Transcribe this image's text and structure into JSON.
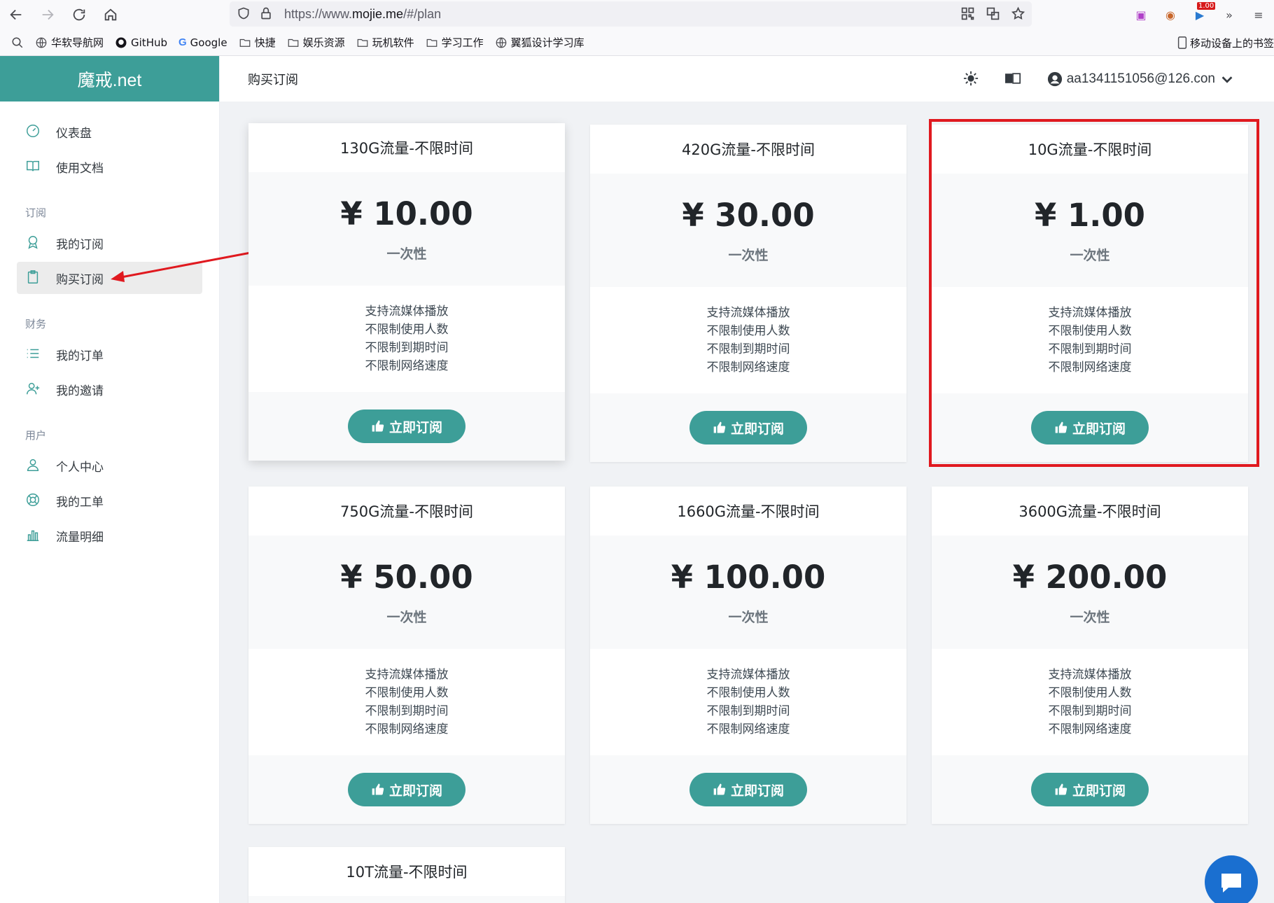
{
  "browser": {
    "url_prefix": "https://www.",
    "url_domain": "mojie.me",
    "url_path": "/#/plan",
    "bookmarks": [
      "华软导航网",
      "GitHub",
      "Google",
      "快捷",
      "娱乐资源",
      "玩机软件",
      "学习工作",
      "翼狐设计学习库"
    ],
    "mobile_bookmarks": "移动设备上的书签",
    "ext_badge": "1.00"
  },
  "app": {
    "brand": "魔戒.net",
    "page_title": "购买订阅",
    "user_email": "aa1341151056@126.con"
  },
  "sidebar": {
    "top_items": [
      {
        "label": "仪表盘",
        "icon": "dashboard-icon"
      },
      {
        "label": "使用文档",
        "icon": "book-icon"
      }
    ],
    "groups": [
      {
        "title": "订阅",
        "items": [
          {
            "label": "我的订阅",
            "icon": "award-icon"
          },
          {
            "label": "购买订阅",
            "icon": "clipboard-icon",
            "active": true
          }
        ]
      },
      {
        "title": "财务",
        "items": [
          {
            "label": "我的订单",
            "icon": "list-icon"
          },
          {
            "label": "我的邀请",
            "icon": "user-plus-icon"
          }
        ]
      },
      {
        "title": "用户",
        "items": [
          {
            "label": "个人中心",
            "icon": "user-icon"
          },
          {
            "label": "我的工单",
            "icon": "support-icon"
          },
          {
            "label": "流量明细",
            "icon": "bar-chart-icon"
          }
        ]
      }
    ]
  },
  "plans": [
    {
      "name": "130G流量-不限时间",
      "price": "¥ 10.00",
      "period": "一次性"
    },
    {
      "name": "420G流量-不限时间",
      "price": "¥ 30.00",
      "period": "一次性"
    },
    {
      "name": "10G流量-不限时间",
      "price": "¥ 1.00",
      "period": "一次性"
    },
    {
      "name": "750G流量-不限时间",
      "price": "¥ 50.00",
      "period": "一次性"
    },
    {
      "name": "1660G流量-不限时间",
      "price": "¥ 100.00",
      "period": "一次性"
    },
    {
      "name": "3600G流量-不限时间",
      "price": "¥ 200.00",
      "period": "一次性"
    },
    {
      "name": "10T流量-不限时间",
      "price": "",
      "period": ""
    }
  ],
  "features": [
    "支持流媒体播放",
    "不限制使用人数",
    "不限制到期时间",
    "不限制网络速度"
  ],
  "subscribe_label": "立即订阅",
  "colors": {
    "brand": "#3d9e98",
    "highlight": "#e0191f",
    "chat": "#1a6fd0"
  }
}
